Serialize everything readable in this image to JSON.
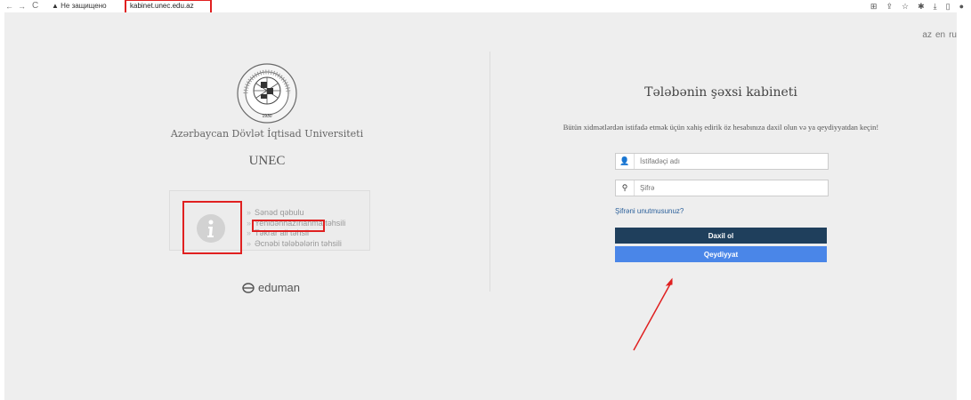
{
  "browser": {
    "back_icon": "←",
    "forward_icon": "→",
    "reload_icon": "C",
    "security_text": "Не защищено",
    "url": "kabinet.unec.edu.az",
    "toolbar_icons": [
      "translate-icon",
      "share-icon",
      "star-icon",
      "extension-icon",
      "download-icon",
      "sidebar-icon",
      "profile-icon"
    ]
  },
  "languages": [
    "az",
    "en",
    "ru"
  ],
  "left": {
    "university_name": "Azərbaycan Dövlət İqtisad Universiteti",
    "short_name": "UNEC",
    "logo_year": "1930",
    "links": [
      "Sənəd qəbulu",
      "Yenidənhazırlanma təhsili",
      "Təkrar ali təhsil",
      "Əcnəbi tələbələrin təhsili"
    ],
    "brand": "eduman"
  },
  "login": {
    "title": "Tələbənin şəxsi kabineti",
    "description": "Bütün xidmətlərdən istifadə etmək üçün xahiş edirik öz hesabınıza daxil olun və ya qeydiyyatdan keçin!",
    "username_placeholder": "İstifadəçi adı",
    "password_placeholder": "Şifrə",
    "forgot_link": "Şifrəni unutmusunuz?",
    "login_button": "Daxil ol",
    "register_button": "Qeydiyyat"
  },
  "colors": {
    "login_button": "#1f3f5c",
    "register_button": "#4a86e8",
    "highlight": "#e02020"
  }
}
